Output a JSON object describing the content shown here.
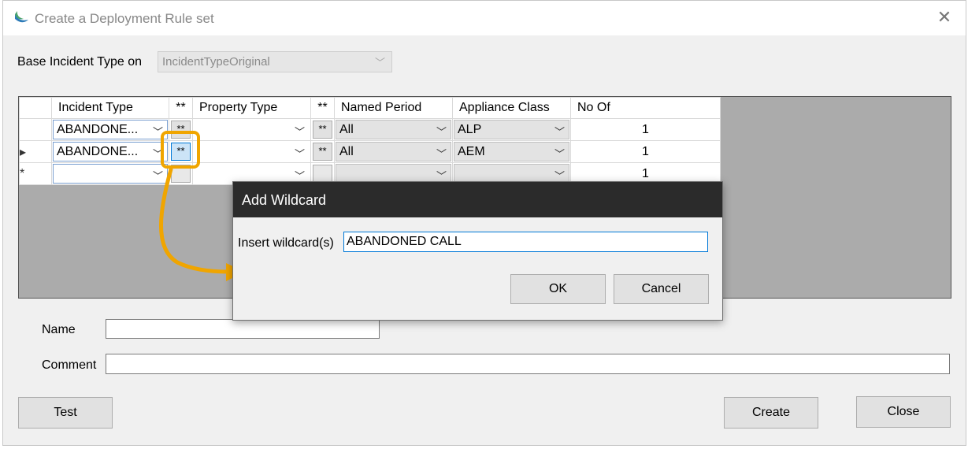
{
  "window": {
    "title": "Create a Deployment Rule set",
    "close_icon": "close-icon"
  },
  "base": {
    "label": "Base Incident Type on",
    "value": "IncidentTypeOriginal"
  },
  "grid": {
    "headers": {
      "incident_type": "Incident Type",
      "star1": "**",
      "property_type": "Property Type",
      "star2": "**",
      "named_period": "Named Period",
      "appliance_class": "Appliance Class",
      "no_of": "No Of"
    },
    "rows": [
      {
        "marker": "",
        "incident_type": "ABANDONE...",
        "star1": "**",
        "property_type": "",
        "star2": "**",
        "named_period": "All",
        "appliance_class": "ALP",
        "no_of": "1"
      },
      {
        "marker": "▸",
        "incident_type": "ABANDONE...",
        "star1": "**",
        "property_type": "",
        "star2": "**",
        "named_period": "All",
        "appliance_class": "AEM",
        "no_of": "1"
      },
      {
        "marker": "*",
        "incident_type": "",
        "star1": "",
        "property_type": "",
        "star2": "",
        "named_period": "",
        "appliance_class": "",
        "no_of": "1"
      }
    ]
  },
  "form": {
    "name_label": "Name",
    "name_value": "",
    "comment_label": "Comment",
    "comment_value": ""
  },
  "buttons": {
    "test": "Test",
    "create": "Create",
    "close": "Close"
  },
  "dialog": {
    "title": "Add Wildcard",
    "label": "Insert wildcard(s)",
    "value": "ABANDONED CALL",
    "ok": "OK",
    "cancel": "Cancel"
  },
  "colors": {
    "highlight": "#f0a500",
    "dialog_title_bg": "#2b2b2b",
    "focus_border": "#0078d7"
  }
}
